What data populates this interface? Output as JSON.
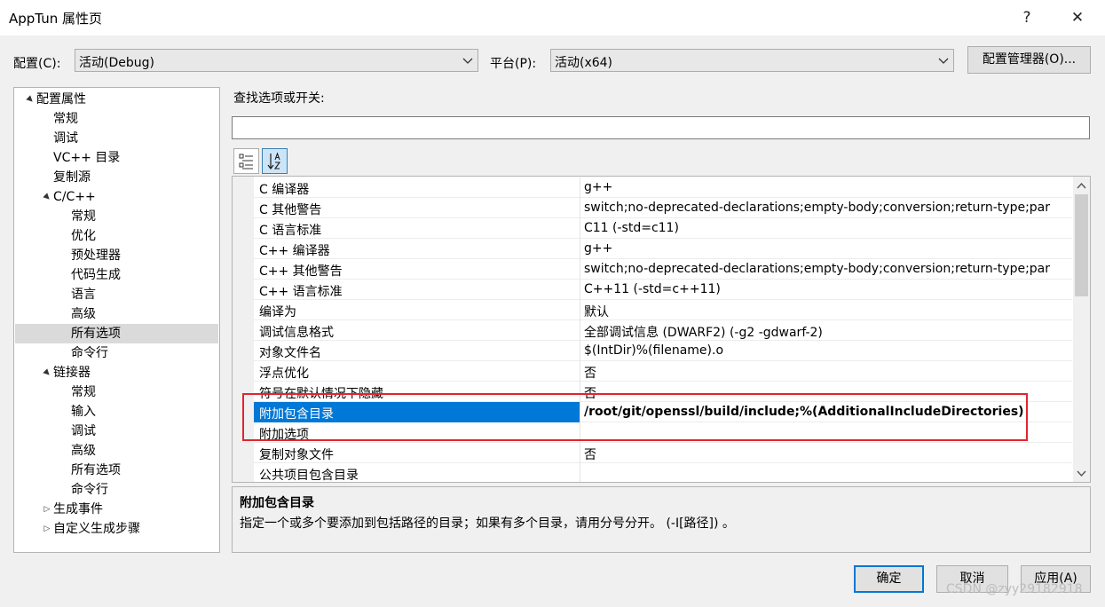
{
  "window": {
    "title": "AppTun 属性页",
    "help_glyph": "?",
    "close_glyph": "✕"
  },
  "config": {
    "config_label": "配置(C):",
    "config_value": "活动(Debug)",
    "platform_label": "平台(P):",
    "platform_value": "活动(x64)",
    "manager_button": "配置管理器(O)..."
  },
  "tree": {
    "items": [
      {
        "label": "配置属性",
        "level": 0,
        "expander": "▲"
      },
      {
        "label": "常规",
        "level": 1,
        "expander": ""
      },
      {
        "label": "调试",
        "level": 1,
        "expander": ""
      },
      {
        "label": "VC++ 目录",
        "level": 1,
        "expander": ""
      },
      {
        "label": "复制源",
        "level": 1,
        "expander": ""
      },
      {
        "label": "C/C++",
        "level": 1,
        "expander": "▲"
      },
      {
        "label": "常规",
        "level": 2,
        "expander": ""
      },
      {
        "label": "优化",
        "level": 2,
        "expander": ""
      },
      {
        "label": "预处理器",
        "level": 2,
        "expander": ""
      },
      {
        "label": "代码生成",
        "level": 2,
        "expander": ""
      },
      {
        "label": "语言",
        "level": 2,
        "expander": ""
      },
      {
        "label": "高级",
        "level": 2,
        "expander": ""
      },
      {
        "label": "所有选项",
        "level": 2,
        "expander": "",
        "selected": true
      },
      {
        "label": "命令行",
        "level": 2,
        "expander": ""
      },
      {
        "label": "链接器",
        "level": 1,
        "expander": "▲"
      },
      {
        "label": "常规",
        "level": 2,
        "expander": ""
      },
      {
        "label": "输入",
        "level": 2,
        "expander": ""
      },
      {
        "label": "调试",
        "level": 2,
        "expander": ""
      },
      {
        "label": "高级",
        "level": 2,
        "expander": ""
      },
      {
        "label": "所有选项",
        "level": 2,
        "expander": ""
      },
      {
        "label": "命令行",
        "level": 2,
        "expander": ""
      },
      {
        "label": "生成事件",
        "level": 1,
        "expander": "▷"
      },
      {
        "label": "自定义生成步骤",
        "level": 1,
        "expander": "▷"
      }
    ]
  },
  "search": {
    "label": "查找选项或开关:",
    "value": ""
  },
  "properties": {
    "rows": [
      {
        "name": "C 编译器",
        "value": "g++"
      },
      {
        "name": "C 其他警告",
        "value": "switch;no-deprecated-declarations;empty-body;conversion;return-type;par"
      },
      {
        "name": "C 语言标准",
        "value": "C11 (-std=c11)"
      },
      {
        "name": "C++ 编译器",
        "value": "g++"
      },
      {
        "name": "C++ 其他警告",
        "value": "switch;no-deprecated-declarations;empty-body;conversion;return-type;par"
      },
      {
        "name": "C++ 语言标准",
        "value": "C++11 (-std=c++11)"
      },
      {
        "name": "编译为",
        "value": "默认"
      },
      {
        "name": "调试信息格式",
        "value": "全部调试信息 (DWARF2) (-g2 -gdwarf-2)"
      },
      {
        "name": "对象文件名",
        "value": "$(IntDir)%(filename).o"
      },
      {
        "name": "浮点优化",
        "value": "否"
      },
      {
        "name": "符号在默认情况下隐藏",
        "value": "否"
      },
      {
        "name": "附加包含目录",
        "value": "/root/git/openssl/build/include;%(AdditionalIncludeDirectories)",
        "selected": true
      },
      {
        "name": "附加选项",
        "value": ""
      },
      {
        "name": "复制对象文件",
        "value": "否"
      },
      {
        "name": "公共项目包含目录",
        "value": ""
      }
    ]
  },
  "description": {
    "title": "附加包含目录",
    "text": "指定一个或多个要添加到包括路径的目录；如果有多个目录，请用分号分开。 (-I[路径]) 。"
  },
  "footer": {
    "ok": "确定",
    "cancel": "取消",
    "apply": "应用(A)"
  },
  "watermark": "CSDN @zyy29182918",
  "colors": {
    "selection": "#0078d7",
    "highlight_box": "#e0262e"
  }
}
